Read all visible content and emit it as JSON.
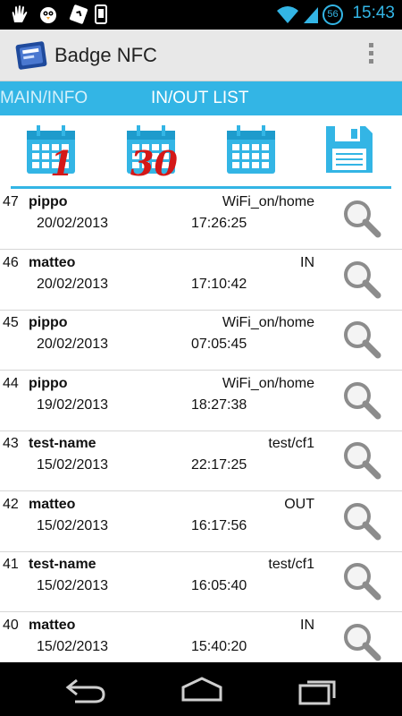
{
  "status_bar": {
    "time": "15:43",
    "notifications": [
      "hand-icon",
      "bird-icon",
      "nfc-icon",
      "phone-icon"
    ],
    "indicators": [
      "wifi-icon",
      "mobile-signal-icon",
      "battery-icon"
    ],
    "badge_number": "56"
  },
  "action_bar": {
    "title": "Badge NFC",
    "logo_icon": "badge-nfc-logo",
    "menu_icon": "overflow-menu-icon"
  },
  "tabs": [
    {
      "label": "MAIN/INFO",
      "active": false
    },
    {
      "label": "IN/OUT LIST",
      "active": true
    }
  ],
  "toolbar": {
    "calendar_1_label": "1",
    "calendar_30_label": "30",
    "calendar_icon": "calendar-icon",
    "save_icon": "floppy-disk-icon"
  },
  "rows": [
    {
      "num": "47",
      "name": "pippo",
      "status": "WiFi_on/home",
      "date": "20/02/2013",
      "time": "17:26:25"
    },
    {
      "num": "46",
      "name": "matteo",
      "status": "IN",
      "date": "20/02/2013",
      "time": "17:10:42"
    },
    {
      "num": "45",
      "name": "pippo",
      "status": "WiFi_on/home",
      "date": "20/02/2013",
      "time": "07:05:45"
    },
    {
      "num": "44",
      "name": "pippo",
      "status": "WiFi_on/home",
      "date": "19/02/2013",
      "time": "18:27:38"
    },
    {
      "num": "43",
      "name": "test-name",
      "status": "test/cf1",
      "date": "15/02/2013",
      "time": "22:17:25"
    },
    {
      "num": "42",
      "name": "matteo",
      "status": "OUT",
      "date": "15/02/2013",
      "time": "16:17:56"
    },
    {
      "num": "41",
      "name": "test-name",
      "status": "test/cf1",
      "date": "15/02/2013",
      "time": "16:05:40"
    },
    {
      "num": "40",
      "name": "matteo",
      "status": "IN",
      "date": "15/02/2013",
      "time": "15:40:20"
    }
  ],
  "colors": {
    "accent": "#33b5e5",
    "calendar_number": "#d41818",
    "icon_grey": "#8c8c8c"
  }
}
